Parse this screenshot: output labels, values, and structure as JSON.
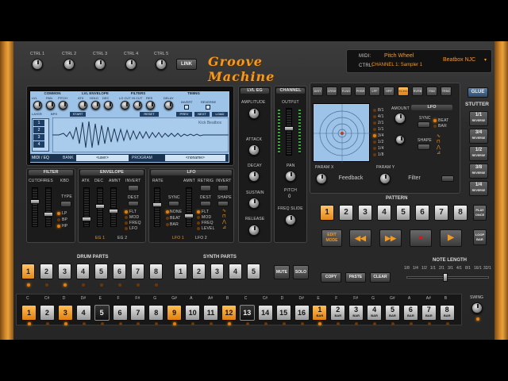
{
  "app": {
    "logo": "Groove Machine"
  },
  "top": {
    "ctrl_labels": [
      "CTRL 1",
      "CTRL 2",
      "CTRL 3",
      "CTRL 4",
      "CTRL 5"
    ],
    "link": "LINK",
    "midi_label": "MIDI:",
    "midi_value": "Pitch Wheel",
    "ctrl_label": "CTRL:",
    "ctrl_value": "CHANNEL 1: Sampler 1",
    "preset": "Beatbox NJC"
  },
  "display": {
    "sections": [
      "COMMON",
      "LVL ENVELOPE",
      "FILTERS",
      "TIMING"
    ],
    "common_knobs": [
      "LVL",
      "PAN",
      "PITCH"
    ],
    "env_knobs": [
      "ATK",
      "HOLD",
      "DEC"
    ],
    "filter_knobs": [
      "LO CUT",
      "HI CUT",
      "RES"
    ],
    "delay": "DELAY",
    "invert": "INVERT",
    "reverse": "REVERSE",
    "layer": "LAYER",
    "bpm": "BPS",
    "start": "START",
    "reset": "RESET",
    "prev": "PREV",
    "next": "NEXT",
    "load": "LOAD",
    "sample_name": "Kick Beatbox",
    "layers": [
      "1",
      "2",
      "3",
      "4"
    ],
    "midi_eq": "MIDI / EQ",
    "bank_label": "BANK",
    "bank_value": "<user>",
    "program_label": "PROGRAM",
    "program_value": "<noname>"
  },
  "lvl_eg": {
    "title": "LVL EG",
    "amplitude": "AMPLITUDE",
    "attack": "ATTACK",
    "decay": "DECAY",
    "sustain": "SUSTAIN",
    "release": "RELEASE"
  },
  "channel": {
    "title": "CHANNEL",
    "output": "OUTPUT",
    "pan": "PAN",
    "pitch": "PITCH",
    "pitch_value": "0",
    "freq_slide": "FREQ SLIDE"
  },
  "filter": {
    "title": "FILTER",
    "labels": [
      "CUTOFF",
      "RES",
      "KBD"
    ],
    "type": "TYPE",
    "types": [
      "LP",
      "BP",
      "HP"
    ]
  },
  "envelope": {
    "title": "ENVELOPE",
    "labels": [
      "ATK",
      "DEC",
      "AMNT",
      "INVERT"
    ],
    "dest": "DEST",
    "dests": [
      "FLT",
      "MOD",
      "FREQ",
      "LFO"
    ],
    "eg1": "EG 1",
    "eg2": "EG 2"
  },
  "lfo": {
    "title": "LFO",
    "labels": [
      "RATE",
      "AMNT",
      "RETRIG",
      "INVERT"
    ],
    "sync": "SYNC",
    "syncs": [
      "NONE",
      "BEAT",
      "BAR"
    ],
    "dest": "DEST",
    "dests": [
      "FLT",
      "MOD",
      "FREQ",
      "LEVEL"
    ],
    "shape": "SHAPE",
    "lfo1": "LFO 1",
    "lfo2": "LFO 2"
  },
  "fx": {
    "tabs": [
      "DIST",
      "CRSH",
      "FLNG",
      "PHSR",
      "LPF",
      "HPF",
      "ECHO",
      "RVRB",
      "PAN",
      "TRNC"
    ],
    "active": "ECHO",
    "rates": [
      "8/1",
      "4/1",
      "2/1",
      "1/1",
      "3/4",
      "1/2",
      "1/4",
      "1/8"
    ],
    "amount": "AMOUNT",
    "lfo": "LFO",
    "sync": "SYNC",
    "beat": "BEAT",
    "bar": "BAR",
    "shape": "SHAPE",
    "param_x": "PARAM X",
    "param_x_value": "Feedback",
    "param_y": "PARAM Y",
    "param_y_value": "Filter"
  },
  "stutter": {
    "glue": "GLUE",
    "title": "STUTTER",
    "buttons": [
      {
        "v": "1/1",
        "s": "REVERSE"
      },
      {
        "v": "3/4",
        "s": "REVERSE"
      },
      {
        "v": "1/2",
        "s": "REVERSE"
      },
      {
        "v": "3/8",
        "s": "REVERSE"
      },
      {
        "v": "1/4",
        "s": "REVERSE"
      }
    ]
  },
  "pattern": {
    "title": "PATTERN",
    "buttons": [
      "1",
      "2",
      "3",
      "4",
      "5",
      "6",
      "7",
      "8"
    ],
    "active": "1",
    "play_once": "PLAY ONCE",
    "loop_bar": "LOOP BAR",
    "edit_mode": "EDIT MODE"
  },
  "parts": {
    "drum_title": "DRUM PARTS",
    "synth_title": "SYNTH PARTS",
    "drum": [
      "1",
      "2",
      "3",
      "4",
      "5",
      "6",
      "7",
      "8"
    ],
    "synth": [
      "1",
      "2",
      "3",
      "4",
      "5"
    ],
    "mute": "MUTE",
    "solo": "SOLO",
    "copy": "COPY",
    "paste": "PASTE",
    "clear": "CLEAR",
    "note_length": "NOTE LENGTH",
    "note_values": [
      "1/8",
      "1/4",
      "1/2",
      "1/1",
      "2/1",
      "3/1",
      "4/1",
      "8/1",
      "16/1",
      "32/1"
    ],
    "swing": "SWING"
  },
  "sequencer": {
    "notes": [
      "C",
      "C#",
      "D",
      "D#",
      "E",
      "F",
      "F#",
      "G",
      "G#",
      "A",
      "A#",
      "B",
      "C",
      "C#",
      "D",
      "D#",
      "E",
      "F",
      "F#",
      "G",
      "G#",
      "A",
      "A#",
      "B"
    ],
    "steps": [
      "1",
      "2",
      "3",
      "4",
      "5",
      "6",
      "7",
      "8",
      "9",
      "10",
      "11",
      "12",
      "13",
      "14",
      "15",
      "16"
    ],
    "bar_steps": [
      "1",
      "2",
      "3",
      "4",
      "5",
      "6",
      "7",
      "8"
    ],
    "bar_label": "BAR"
  },
  "colors": {
    "accent": "#f39a22",
    "lcd": "#9ec3e8",
    "panel": "#2b2b2b"
  }
}
